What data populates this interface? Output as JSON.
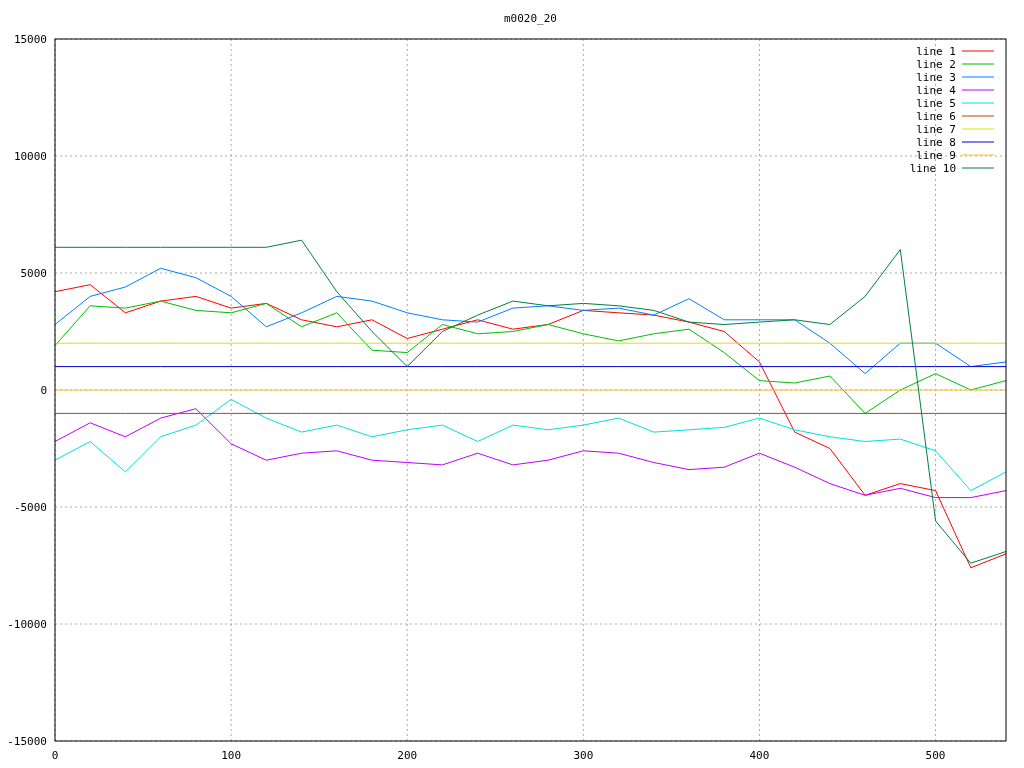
{
  "chart_data": {
    "type": "line",
    "title": "m0020_20",
    "x": [
      0,
      20,
      40,
      60,
      80,
      100,
      120,
      140,
      160,
      180,
      200,
      220,
      240,
      260,
      280,
      300,
      320,
      340,
      360,
      380,
      400,
      420,
      440,
      460,
      480,
      500,
      520,
      540
    ],
    "xlim": [
      0,
      540
    ],
    "ylim": [
      -15000,
      15000
    ],
    "xticks": [
      0,
      100,
      200,
      300,
      400,
      500
    ],
    "yticks": [
      -15000,
      -10000,
      -5000,
      0,
      5000,
      10000,
      15000
    ],
    "grid": true,
    "legend": true,
    "series": [
      {
        "name": "line 1",
        "color": "#ff0000",
        "values": [
          4200,
          4500,
          3300,
          3800,
          4000,
          3500,
          3700,
          3000,
          2700,
          3000,
          2200,
          2600,
          3000,
          2600,
          2800,
          3400,
          3300,
          3200,
          2900,
          2500,
          1200,
          -1800,
          -2500,
          -4500,
          -4000,
          -4300,
          -7600,
          -7000
        ]
      },
      {
        "name": "line 2",
        "color": "#00c000",
        "values": [
          1900,
          3600,
          3500,
          3800,
          3400,
          3300,
          3700,
          2700,
          3300,
          1700,
          1600,
          2800,
          2400,
          2500,
          2800,
          2400,
          2100,
          2400,
          2600,
          1600,
          400,
          300,
          600,
          -1000,
          0,
          700,
          0,
          400
        ]
      },
      {
        "name": "line 3",
        "color": "#0080ff",
        "values": [
          2800,
          4000,
          4400,
          5200,
          4800,
          4000,
          2700,
          3300,
          4000,
          3800,
          3300,
          3000,
          2900,
          3500,
          3600,
          3400,
          3500,
          3200,
          3900,
          3000,
          3000,
          3000,
          2000,
          700,
          2000,
          2000,
          1000,
          1200
        ]
      },
      {
        "name": "line 4",
        "color": "#c000ff",
        "values": [
          -2200,
          -1400,
          -2000,
          -1200,
          -800,
          -2300,
          -3000,
          -2700,
          -2600,
          -3000,
          -3100,
          -3200,
          -2700,
          -3200,
          -3000,
          -2600,
          -2700,
          -3100,
          -3400,
          -3300,
          -2700,
          -3300,
          -4000,
          -4500,
          -4200,
          -4600,
          -4600,
          -4300
        ]
      },
      {
        "name": "line 5",
        "color": "#00e0e0",
        "values": [
          -3000,
          -2200,
          -3500,
          -2000,
          -1500,
          -400,
          -1200,
          -1800,
          -1500,
          -2000,
          -1700,
          -1500,
          -2200,
          -1500,
          -1700,
          -1500,
          -1200,
          -1800,
          -1700,
          -1600,
          -1200,
          -1700,
          -2000,
          -2200,
          -2100,
          -2600,
          -4300,
          -3500
        ]
      },
      {
        "name": "line 6",
        "color": "#c04000",
        "values": [
          -1000,
          -1000,
          -1000,
          -1000,
          -1000,
          -1000,
          -1000,
          -1000,
          -1000,
          -1000,
          -1000,
          -1000,
          -1000,
          -1000,
          -1000,
          -1000,
          -1000,
          -1000,
          -1000,
          -1000,
          -1000,
          -1000,
          -1000,
          -1000,
          -1000,
          -1000,
          -1000,
          -1000
        ]
      },
      {
        "name": "line 7",
        "color": "#e0e000",
        "values": [
          2000,
          2000,
          2000,
          2000,
          2000,
          2000,
          2000,
          2000,
          2000,
          2000,
          2000,
          2000,
          2000,
          2000,
          2000,
          2000,
          2000,
          2000,
          2000,
          2000,
          2000,
          2000,
          2000,
          2000,
          2000,
          2000,
          2000,
          2000
        ]
      },
      {
        "name": "line 8",
        "color": "#0000d0",
        "values": [
          1000,
          1000,
          1000,
          1000,
          1000,
          1000,
          1000,
          1000,
          1000,
          1000,
          1000,
          1000,
          1000,
          1000,
          1000,
          1000,
          1000,
          1000,
          1000,
          1000,
          1000,
          1000,
          1000,
          1000,
          1000,
          1000,
          1000,
          1000
        ]
      },
      {
        "name": "line 9",
        "color": "#ffc020",
        "values": [
          0,
          0,
          0,
          0,
          0,
          0,
          0,
          0,
          0,
          0,
          0,
          0,
          0,
          0,
          0,
          0,
          0,
          0,
          0,
          0,
          0,
          0,
          0,
          0,
          0,
          0,
          0,
          0
        ]
      },
      {
        "name": "line 10",
        "color": "#008040",
        "values": [
          6100,
          6100,
          6100,
          6100,
          6100,
          6100,
          6100,
          6400,
          4200,
          2500,
          1000,
          2500,
          3200,
          3800,
          3600,
          3700,
          3600,
          3400,
          2900,
          2800,
          2900,
          3000,
          2800,
          4000,
          6000,
          -5600,
          -7400,
          -6900
        ]
      }
    ]
  }
}
